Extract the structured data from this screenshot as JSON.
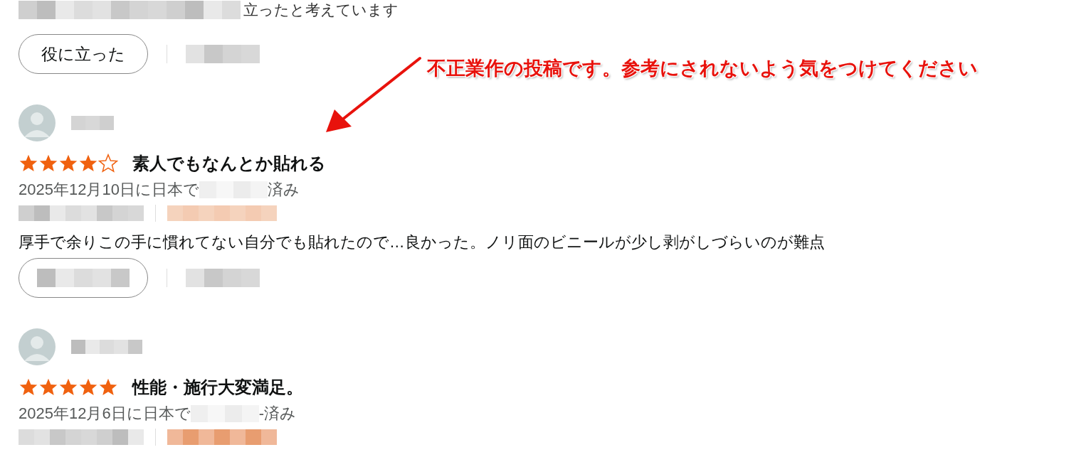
{
  "top_fragment": {
    "text": "立ったと考えています"
  },
  "helpful_button": {
    "label": "役に立った"
  },
  "annotation": {
    "text": "不正業作の投稿です。参考にされないよう気をつけてください"
  },
  "reviews": [
    {
      "stars": 4,
      "title": "素人でもなんとか貼れる",
      "date_prefix": "2025年12月10日に日本で",
      "date_suffix": "済み",
      "body": "厚手で余りこの手に慣れてない自分でも貼れたので…良かった。ノリ面のビニールが少し剥がしづらいのが難点"
    },
    {
      "stars": 5,
      "title": "性能・施行大変満足。",
      "date_prefix": "2025年12月6日に日本で",
      "date_suffix": "-済み"
    }
  ]
}
